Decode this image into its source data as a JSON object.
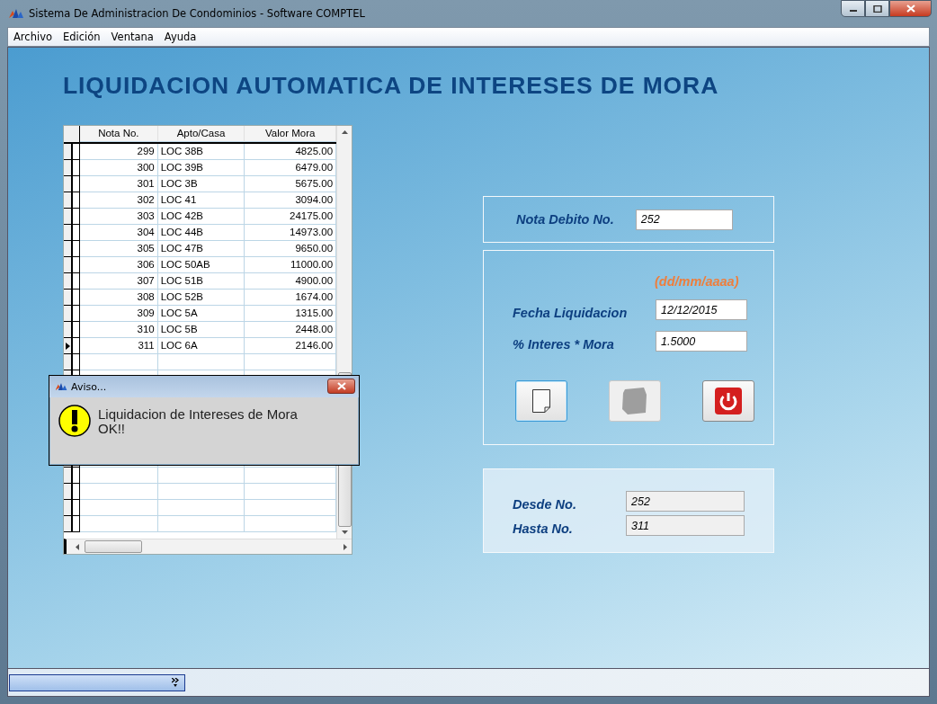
{
  "window": {
    "title": "Sistema De Administracion De Condominios - Software COMPTEL"
  },
  "menu": [
    "Archivo",
    "Edición",
    "Ventana",
    "Ayuda"
  ],
  "heading": "LIQUIDACION AUTOMATICA DE INTERESES DE MORA",
  "table": {
    "columns": [
      "Nota No.",
      "Apto/Casa",
      "Valor Mora"
    ],
    "rows": [
      {
        "cells": [
          "299",
          "LOC 38B",
          "4825.00"
        ],
        "selected": false
      },
      {
        "cells": [
          "300",
          "LOC 39B",
          "6479.00"
        ],
        "selected": false
      },
      {
        "cells": [
          "301",
          "LOC 3B",
          "5675.00"
        ],
        "selected": false
      },
      {
        "cells": [
          "302",
          "LOC 41",
          "3094.00"
        ],
        "selected": false
      },
      {
        "cells": [
          "303",
          "LOC 42B",
          "24175.00"
        ],
        "selected": false
      },
      {
        "cells": [
          "304",
          "LOC 44B",
          "14973.00"
        ],
        "selected": false
      },
      {
        "cells": [
          "305",
          "LOC 47B",
          "9650.00"
        ],
        "selected": false
      },
      {
        "cells": [
          "306",
          "LOC 50AB",
          "11000.00"
        ],
        "selected": false
      },
      {
        "cells": [
          "307",
          "LOC 51B",
          "4900.00"
        ],
        "selected": false
      },
      {
        "cells": [
          "308",
          "LOC 52B",
          "1674.00"
        ],
        "selected": false
      },
      {
        "cells": [
          "309",
          "LOC 5A",
          "1315.00"
        ],
        "selected": false
      },
      {
        "cells": [
          "310",
          "LOC 5B",
          "2448.00"
        ],
        "selected": false
      },
      {
        "cells": [
          "311",
          "LOC 6A",
          "2146.00"
        ],
        "selected": true
      }
    ]
  },
  "dialog": {
    "title": "Aviso...",
    "message_lines": [
      "Liquidacion de Intereses de Mora",
      "OK!!"
    ]
  },
  "nota_debito": {
    "label": "Nota Debito No.",
    "value": "252"
  },
  "liquidacion": {
    "date_hint": "(dd/mm/aaaa)",
    "fields": [
      {
        "label": "Fecha Liquidacion",
        "value": "12/12/2015"
      },
      {
        "label": "% Interes  * Mora",
        "value": "1.5000"
      }
    ],
    "buttons": [
      {
        "kind": "new",
        "disabled": false
      },
      {
        "kind": "blank",
        "disabled": true
      },
      {
        "kind": "exit",
        "disabled": false
      }
    ]
  },
  "rango": {
    "fields": [
      {
        "label": "Desde No.",
        "value": "252"
      },
      {
        "label": "Hasta No.",
        "value": "311"
      }
    ]
  }
}
